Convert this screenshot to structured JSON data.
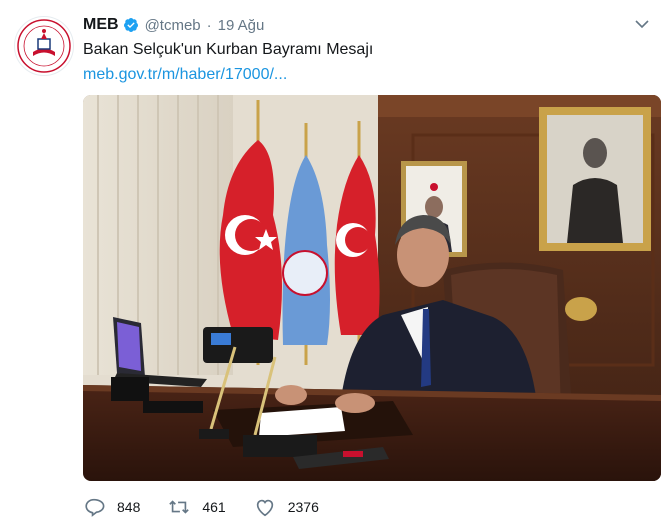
{
  "tweet": {
    "author_name": "MEB",
    "handle": "@tcmeb",
    "separator": "·",
    "date": "19 Ağu",
    "text": "Bakan Selçuk'un Kurban Bayramı Mesajı",
    "link_text": "meb.gov.tr/m/haber/17000/...",
    "avatar_icon": "meb-logo-icon",
    "verified_icon": "verified-badge-icon",
    "menu_icon": "chevron-down-icon",
    "photo_description_icon": "tweet-photo"
  },
  "actions": {
    "reply_count": "848",
    "retweet_count": "461",
    "like_count": "2376",
    "reply_icon": "reply-icon",
    "retweet_icon": "retweet-icon",
    "like_icon": "heart-icon"
  },
  "colors": {
    "link": "#1b95e0",
    "secondary_text": "#657786",
    "verified": "#1da1f2",
    "flag_red": "#d6202a"
  }
}
